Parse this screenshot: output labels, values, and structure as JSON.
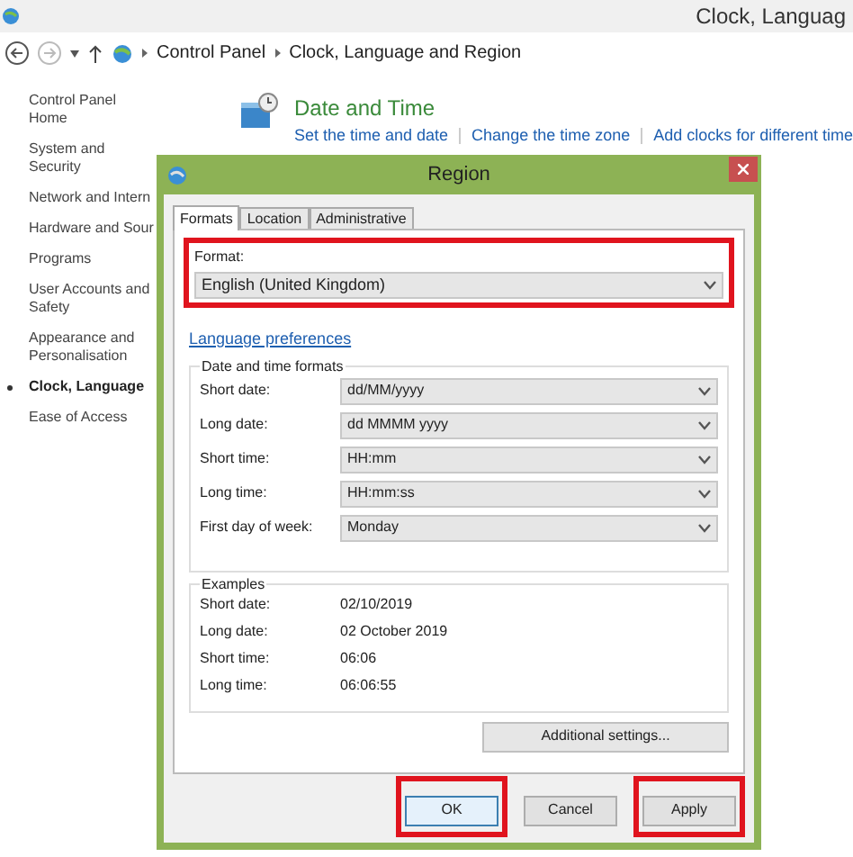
{
  "window": {
    "title": "Clock, Languag"
  },
  "breadcrumb": [
    "Control Panel",
    "Clock, Language and Region"
  ],
  "sidebar": {
    "items": [
      {
        "label": "Control Panel Home",
        "selected": false
      },
      {
        "label": "System and Security",
        "selected": false
      },
      {
        "label": "Network and Intern",
        "selected": false
      },
      {
        "label": "Hardware and Sour",
        "selected": false
      },
      {
        "label": "Programs",
        "selected": false
      },
      {
        "label": "User Accounts and Safety",
        "selected": false
      },
      {
        "label": "Appearance and Personalisation",
        "selected": false
      },
      {
        "label": "Clock, Language",
        "selected": true
      },
      {
        "label": "Ease of Access",
        "selected": false
      }
    ]
  },
  "section": {
    "title": "Date and Time",
    "links": [
      "Set the time and date",
      "Change the time zone",
      "Add clocks for different time"
    ]
  },
  "dialog": {
    "title": "Region",
    "tabs": [
      {
        "label": "Formats",
        "selected": true
      },
      {
        "label": "Location",
        "selected": false
      },
      {
        "label": "Administrative",
        "selected": false
      }
    ],
    "format": {
      "label": "Format:",
      "value": "English (United Kingdom)",
      "highlighted": true
    },
    "language_link": "Language preferences",
    "formats_group": {
      "title": "Date and time formats",
      "rows": [
        {
          "label": "Short date:",
          "value": "dd/MM/yyyy"
        },
        {
          "label": "Long date:",
          "value": "dd MMMM yyyy"
        },
        {
          "label": "Short time:",
          "value": "HH:mm"
        },
        {
          "label": "Long time:",
          "value": "HH:mm:ss"
        },
        {
          "label": "First day of week:",
          "value": "Monday"
        }
      ]
    },
    "examples_group": {
      "title": "Examples",
      "rows": [
        {
          "label": "Short date:",
          "value": "02/10/2019"
        },
        {
          "label": "Long date:",
          "value": "02 October 2019"
        },
        {
          "label": "Short time:",
          "value": "06:06"
        },
        {
          "label": "Long time:",
          "value": "06:06:55"
        }
      ]
    },
    "additional_button": "Additional settings...",
    "buttons": [
      {
        "label": "OK",
        "highlighted": true
      },
      {
        "label": "Cancel",
        "highlighted": false
      },
      {
        "label": "Apply",
        "highlighted": true
      }
    ]
  }
}
